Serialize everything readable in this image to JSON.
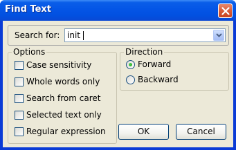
{
  "window": {
    "title": "Find Text",
    "close_icon": "close-icon"
  },
  "search": {
    "label": "Search for:",
    "value": "init",
    "dropdown_icon": "chevron-down-icon"
  },
  "options": {
    "title": "Options",
    "items": [
      {
        "label": "Case sensitivity",
        "checked": false
      },
      {
        "label": "Whole words only",
        "checked": false
      },
      {
        "label": "Search from caret",
        "checked": false
      },
      {
        "label": "Selected text only",
        "checked": false
      },
      {
        "label": "Regular expression",
        "checked": false
      }
    ]
  },
  "direction": {
    "title": "Direction",
    "items": [
      {
        "label": "Forward",
        "selected": true
      },
      {
        "label": "Backward",
        "selected": false
      }
    ]
  },
  "buttons": {
    "ok": "OK",
    "cancel": "Cancel"
  },
  "colors": {
    "titlebar": "#0455e6",
    "dialog_bg": "#ece9d8",
    "close_button": "#d95c38",
    "radio_selected": "#21a121"
  }
}
